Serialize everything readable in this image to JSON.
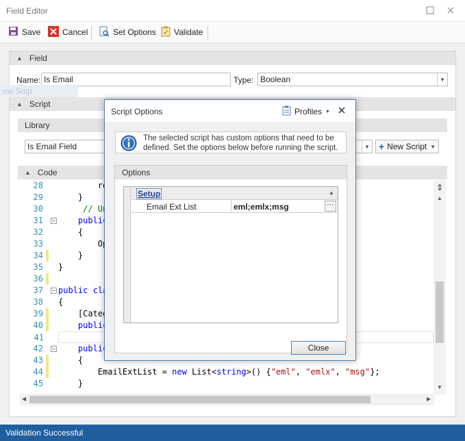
{
  "window": {
    "title": "Field Editor"
  },
  "toolbar": {
    "save_label": "Save",
    "cancel_label": "Cancel",
    "set_options_label": "Set Options",
    "validate_label": "Validate"
  },
  "field_group": {
    "header": "Field",
    "name_label": "Name:",
    "name_value": "Is Email",
    "type_label": "Type:",
    "type_value": "Boolean"
  },
  "ghost_hint": "ow Snip",
  "script_group": {
    "header": "Script",
    "library": {
      "header": "Library",
      "value": "Is Email Field",
      "new_script_label": "New Script"
    },
    "code": {
      "header": "Code",
      "lines": [
        {
          "n": "28",
          "text": "        re"
        },
        {
          "n": "29",
          "text": "    }"
        },
        {
          "n": "30",
          "text": "     // Un"
        },
        {
          "n": "31",
          "text": "    public"
        },
        {
          "n": "32",
          "text": "    {"
        },
        {
          "n": "33",
          "text": "        Op"
        },
        {
          "n": "34",
          "text": "    }"
        },
        {
          "n": "35",
          "text": "}"
        },
        {
          "n": "36",
          "text": ""
        },
        {
          "n": "37",
          "text": "public cla"
        },
        {
          "n": "38",
          "text": "{"
        },
        {
          "n": "39",
          "text": "    [Categ"
        },
        {
          "n": "40",
          "text": "    public"
        },
        {
          "n": "41",
          "text": ""
        },
        {
          "n": "42",
          "text": "    public"
        },
        {
          "n": "43",
          "text": "    {"
        },
        {
          "n": "44",
          "text": "        EmailExtList = new List<string>() {\"eml\", \"emlx\", \"msg\"};"
        },
        {
          "n": "45",
          "text": "    }"
        }
      ]
    }
  },
  "dialog": {
    "title": "Script Options",
    "profiles_label": "Profiles",
    "info_text_1": "The selected script has custom options that need to be",
    "info_text_2": "defined. Set the options below before running the script.",
    "options_header": "Options",
    "grid": {
      "category": "Setup",
      "row_label": "Email Ext List",
      "row_value": "eml;emlx;msg"
    },
    "close_label": "Close"
  },
  "status": {
    "text": "Validation Successful"
  },
  "colors": {
    "accent": "#1f5f9f",
    "status_bg": "#1f5f9f",
    "dialog_border": "#4a7fb8",
    "line_number": "#2b91af"
  }
}
